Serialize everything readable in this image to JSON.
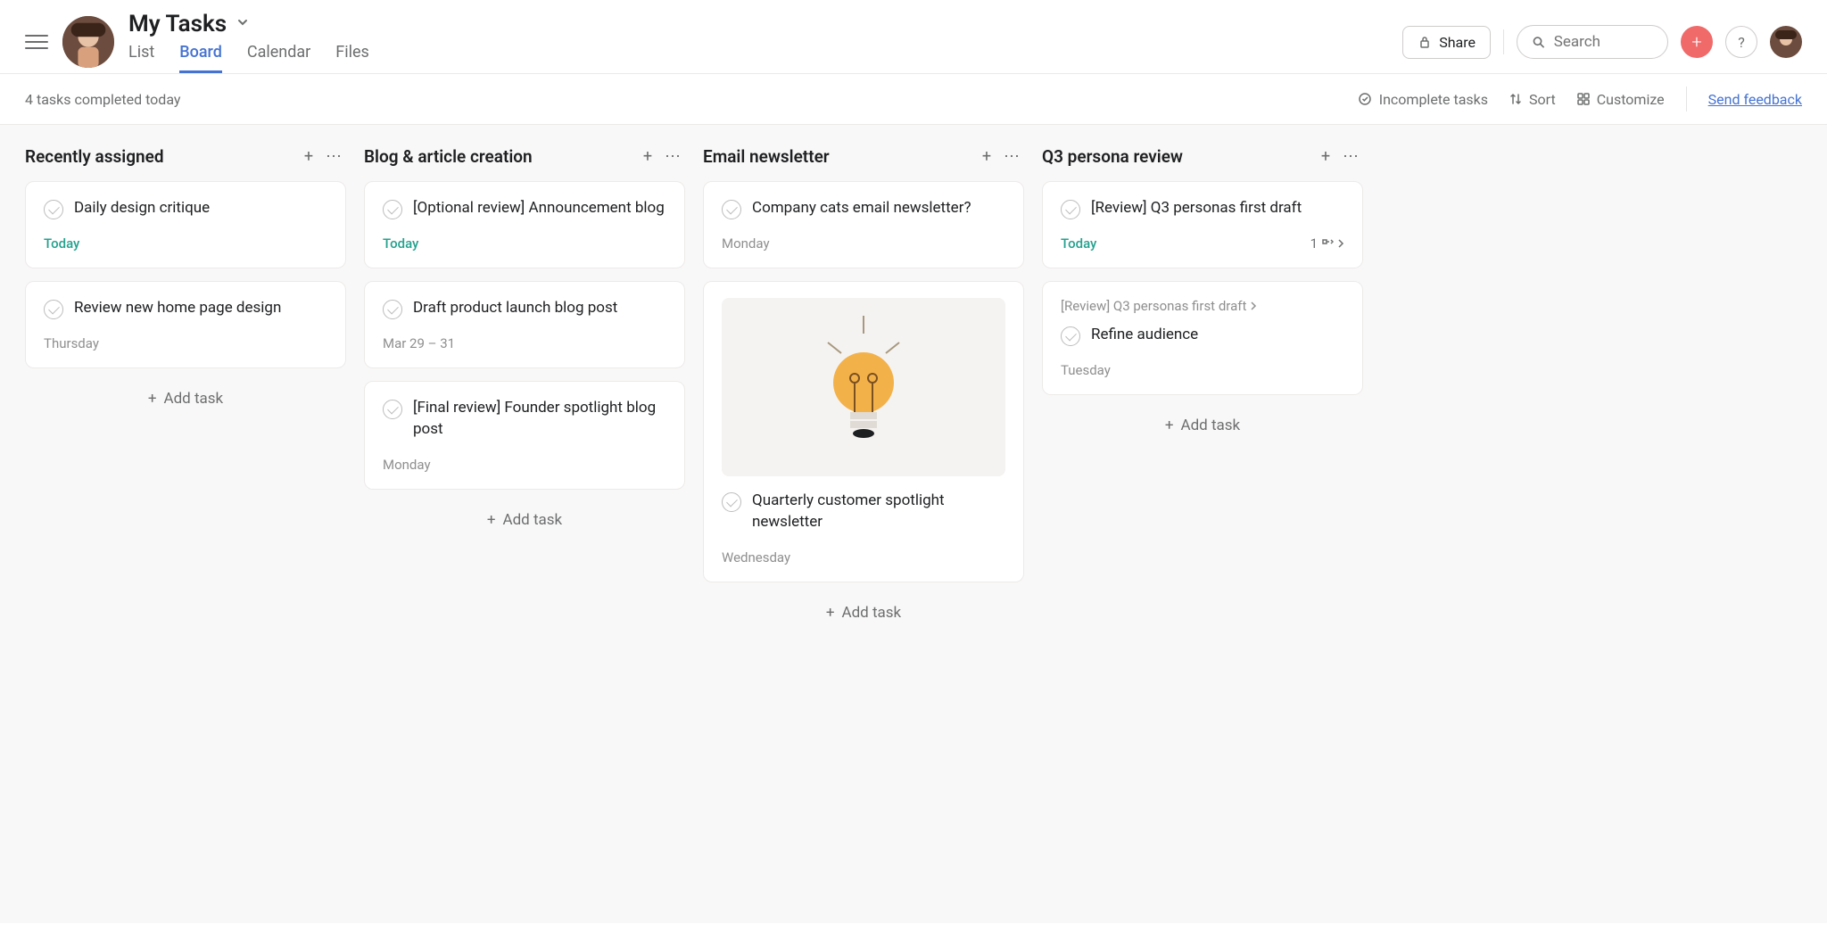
{
  "header": {
    "page_title": "My Tasks",
    "tabs": [
      "List",
      "Board",
      "Calendar",
      "Files"
    ],
    "active_tab": 1,
    "share_label": "Share",
    "search_placeholder": "Search"
  },
  "toolbar": {
    "status_text": "4 tasks completed today",
    "incomplete_label": "Incomplete tasks",
    "sort_label": "Sort",
    "customize_label": "Customize",
    "feedback_label": "Send feedback"
  },
  "add_task_label": "Add task",
  "columns": [
    {
      "title": "Recently assigned",
      "cards": [
        {
          "title": "Daily design critique",
          "due": "Today",
          "due_style": "today"
        },
        {
          "title": "Review new home page design",
          "due": "Thursday",
          "due_style": "normal"
        }
      ]
    },
    {
      "title": "Blog & article creation",
      "cards": [
        {
          "title": "[Optional review] Announcement blog",
          "due": "Today",
          "due_style": "today"
        },
        {
          "title": "Draft product launch blog post",
          "due": "Mar 29 – 31",
          "due_style": "normal"
        },
        {
          "title": "[Final review] Founder spotlight blog post",
          "due": "Monday",
          "due_style": "normal"
        }
      ]
    },
    {
      "title": "Email newsletter",
      "cards": [
        {
          "title": "Company cats email newsletter?",
          "due": "Monday",
          "due_style": "normal"
        },
        {
          "title": "Quarterly customer spotlight newsletter",
          "due": "Wednesday",
          "due_style": "normal",
          "has_image": true
        }
      ]
    },
    {
      "title": "Q3 persona review",
      "cards": [
        {
          "title": "[Review] Q3 personas first draft",
          "due": "Today",
          "due_style": "today",
          "subtasks": "1"
        },
        {
          "title": "Refine audience",
          "due": "Tuesday",
          "due_style": "normal",
          "parent": "[Review] Q3 personas first draft"
        }
      ]
    }
  ]
}
